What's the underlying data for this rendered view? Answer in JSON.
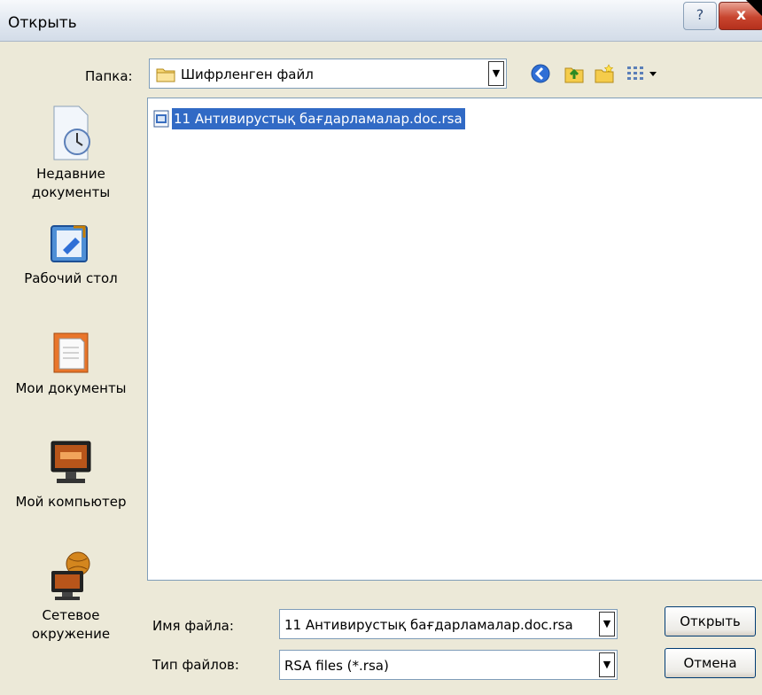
{
  "window": {
    "title": "Открыть",
    "help_glyph": "?",
    "close_glyph": "x"
  },
  "folder": {
    "label": "Папка:",
    "value": "Шифрленген файл"
  },
  "toolbar_icons": [
    "back-icon",
    "up-folder-icon",
    "new-folder-icon",
    "views-menu-icon"
  ],
  "places": [
    {
      "name": "recent-documents",
      "label_line1": "Недавние",
      "label_line2": "документы",
      "icon": "recent-documents-icon"
    },
    {
      "name": "desktop",
      "label_line1": "Рабочий стол",
      "label_line2": "",
      "icon": "desktop-icon"
    },
    {
      "name": "my-documents",
      "label_line1": "Мои документы",
      "label_line2": "",
      "icon": "my-documents-icon"
    },
    {
      "name": "my-computer",
      "label_line1": "Мой компьютер",
      "label_line2": "",
      "icon": "my-computer-icon"
    },
    {
      "name": "network",
      "label_line1": "Сетевое",
      "label_line2": "окружение",
      "icon": "network-icon"
    }
  ],
  "files": [
    {
      "name": "11  Антивирустық бағдарламалар.doc.rsa",
      "selected": true,
      "icon": "rsa-file-icon"
    }
  ],
  "filename": {
    "label": "Имя файла:",
    "value": "11  Антивирустық бағдарламалар.doc.rsa"
  },
  "filetype": {
    "label": "Тип файлов:",
    "value": "RSA files (*.rsa)"
  },
  "buttons": {
    "open": "Открыть",
    "cancel": "Отмена"
  },
  "colors": {
    "selection": "#316ac5",
    "dialog_bg": "#ece9d8",
    "field_border": "#7f9db9"
  }
}
